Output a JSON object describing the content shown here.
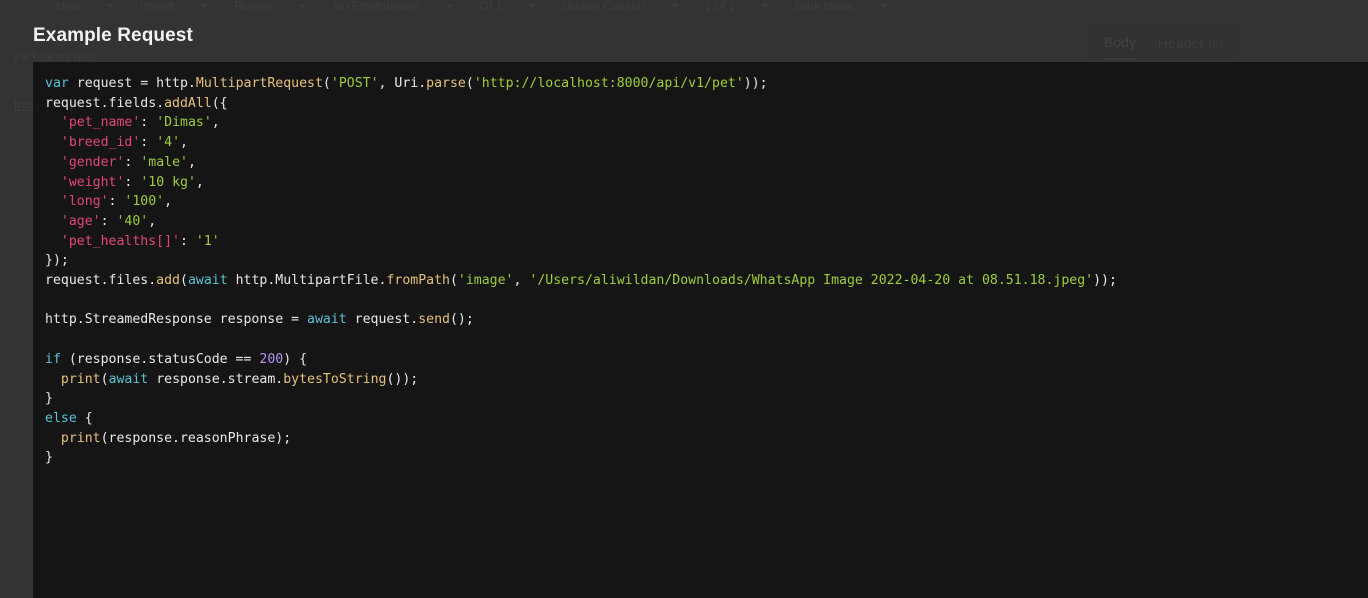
{
  "backdrop": {
    "topbar": {
      "items": [
        "New",
        "Import",
        "Runner",
        "No Environment",
        "Of 1",
        "Double Column",
        "1 of 1",
        "Dark Mode"
      ]
    },
    "sidebar": {
      "brand": "PETCENTRIC",
      "link": "Introduction"
    },
    "response_tabs": [
      {
        "label": "Body",
        "active": true,
        "badge": ""
      },
      {
        "label": "Header",
        "active": false,
        "badge": "(6)"
      }
    ]
  },
  "panel": {
    "title": "Example Request",
    "language": "dart",
    "code_lines": [
      [
        {
          "t": "var",
          "c": "kw"
        },
        {
          "t": " request = http.",
          "c": "pn"
        },
        {
          "t": "MultipartRequest",
          "c": "fn"
        },
        {
          "t": "(",
          "c": "pn"
        },
        {
          "t": "'POST'",
          "c": "str"
        },
        {
          "t": ", Uri.",
          "c": "pn"
        },
        {
          "t": "parse",
          "c": "fn"
        },
        {
          "t": "(",
          "c": "pn"
        },
        {
          "t": "'http://localhost:8000/api/v1/pet'",
          "c": "str"
        },
        {
          "t": "));",
          "c": "pn"
        }
      ],
      [
        {
          "t": "request.fields.",
          "c": "pn"
        },
        {
          "t": "addAll",
          "c": "fn"
        },
        {
          "t": "({",
          "c": "pn"
        }
      ],
      [
        {
          "t": "  ",
          "c": "pn"
        },
        {
          "t": "'pet_name'",
          "c": "key"
        },
        {
          "t": ": ",
          "c": "pn"
        },
        {
          "t": "'Dimas'",
          "c": "str"
        },
        {
          "t": ",",
          "c": "pn"
        }
      ],
      [
        {
          "t": "  ",
          "c": "pn"
        },
        {
          "t": "'breed_id'",
          "c": "key"
        },
        {
          "t": ": ",
          "c": "pn"
        },
        {
          "t": "'4'",
          "c": "str"
        },
        {
          "t": ",",
          "c": "pn"
        }
      ],
      [
        {
          "t": "  ",
          "c": "pn"
        },
        {
          "t": "'gender'",
          "c": "key"
        },
        {
          "t": ": ",
          "c": "pn"
        },
        {
          "t": "'male'",
          "c": "str"
        },
        {
          "t": ",",
          "c": "pn"
        }
      ],
      [
        {
          "t": "  ",
          "c": "pn"
        },
        {
          "t": "'weight'",
          "c": "key"
        },
        {
          "t": ": ",
          "c": "pn"
        },
        {
          "t": "'10 kg'",
          "c": "str"
        },
        {
          "t": ",",
          "c": "pn"
        }
      ],
      [
        {
          "t": "  ",
          "c": "pn"
        },
        {
          "t": "'long'",
          "c": "key"
        },
        {
          "t": ": ",
          "c": "pn"
        },
        {
          "t": "'100'",
          "c": "str"
        },
        {
          "t": ",",
          "c": "pn"
        }
      ],
      [
        {
          "t": "  ",
          "c": "pn"
        },
        {
          "t": "'age'",
          "c": "key"
        },
        {
          "t": ": ",
          "c": "pn"
        },
        {
          "t": "'40'",
          "c": "str"
        },
        {
          "t": ",",
          "c": "pn"
        }
      ],
      [
        {
          "t": "  ",
          "c": "pn"
        },
        {
          "t": "'pet_healths[]'",
          "c": "key"
        },
        {
          "t": ": ",
          "c": "pn"
        },
        {
          "t": "'1'",
          "c": "str"
        }
      ],
      [
        {
          "t": "});",
          "c": "pn"
        }
      ],
      [
        {
          "t": "request.files.",
          "c": "pn"
        },
        {
          "t": "add",
          "c": "fn"
        },
        {
          "t": "(",
          "c": "pn"
        },
        {
          "t": "await",
          "c": "kw"
        },
        {
          "t": " http.MultipartFile.",
          "c": "pn"
        },
        {
          "t": "fromPath",
          "c": "fn"
        },
        {
          "t": "(",
          "c": "pn"
        },
        {
          "t": "'image'",
          "c": "str"
        },
        {
          "t": ", ",
          "c": "pn"
        },
        {
          "t": "'/Users/aliwildan/Downloads/WhatsApp Image 2022-04-20 at 08.51.18.jpeg'",
          "c": "str"
        },
        {
          "t": "));",
          "c": "pn"
        }
      ],
      [],
      [
        {
          "t": "http.StreamedResponse response = ",
          "c": "pn"
        },
        {
          "t": "await",
          "c": "kw"
        },
        {
          "t": " request.",
          "c": "pn"
        },
        {
          "t": "send",
          "c": "fn"
        },
        {
          "t": "();",
          "c": "pn"
        }
      ],
      [],
      [
        {
          "t": "if",
          "c": "kw"
        },
        {
          "t": " (response.statusCode == ",
          "c": "pn"
        },
        {
          "t": "200",
          "c": "num"
        },
        {
          "t": ") {",
          "c": "pn"
        }
      ],
      [
        {
          "t": "  ",
          "c": "pn"
        },
        {
          "t": "print",
          "c": "fn"
        },
        {
          "t": "(",
          "c": "pn"
        },
        {
          "t": "await",
          "c": "kw"
        },
        {
          "t": " response.stream.",
          "c": "pn"
        },
        {
          "t": "bytesToString",
          "c": "fn"
        },
        {
          "t": "());",
          "c": "pn"
        }
      ],
      [
        {
          "t": "}",
          "c": "pn"
        }
      ],
      [
        {
          "t": "else",
          "c": "kw"
        },
        {
          "t": " {",
          "c": "pn"
        }
      ],
      [
        {
          "t": "  ",
          "c": "pn"
        },
        {
          "t": "print",
          "c": "fn"
        },
        {
          "t": "(response.reasonPhrase);",
          "c": "pn"
        }
      ],
      [
        {
          "t": "}",
          "c": "pn"
        }
      ]
    ]
  }
}
